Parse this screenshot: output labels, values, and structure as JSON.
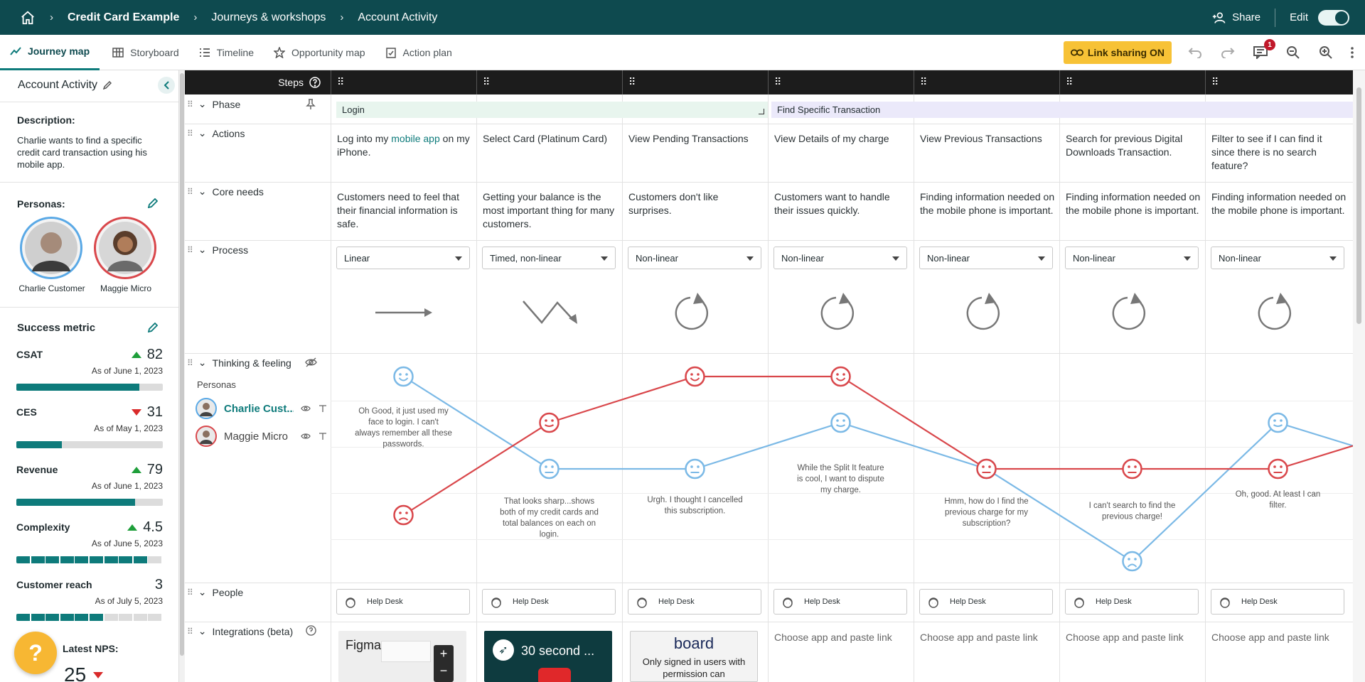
{
  "header": {
    "breadcrumbs": [
      "Credit Card Example",
      "Journeys & workshops",
      "Account Activity"
    ],
    "share_label": "Share",
    "edit_label": "Edit",
    "edit_on": true
  },
  "tabs": [
    {
      "label": "Journey map",
      "active": true,
      "icon": "line-chart-icon"
    },
    {
      "label": "Storyboard",
      "active": false,
      "icon": "grid-icon"
    },
    {
      "label": "Timeline",
      "active": false,
      "icon": "list-icon"
    },
    {
      "label": "Opportunity map",
      "active": false,
      "icon": "star-icon"
    },
    {
      "label": "Action plan",
      "active": false,
      "icon": "clipboard-check-icon"
    }
  ],
  "toolbar": {
    "link_sharing_label": "Link sharing ON",
    "comments_count": "1"
  },
  "sidebar": {
    "title": "Account Activity",
    "description_label": "Description:",
    "description": "Charlie wants to find a specific credit card transaction using his mobile app.",
    "personas_label": "Personas:",
    "personas": [
      {
        "name": "Charlie Customer",
        "ring": "#5aa9e6"
      },
      {
        "name": "Maggie Micro",
        "ring": "#d9474b"
      }
    ],
    "success_metric_label": "Success metric",
    "metrics": [
      {
        "name": "CSAT",
        "value": "82",
        "trend": "up",
        "asof": "As of June 1, 2023",
        "progress": 0.84,
        "segmented": false
      },
      {
        "name": "CES",
        "value": "31",
        "trend": "down",
        "asof": "As of May 1, 2023",
        "progress": 0.31,
        "segmented": false
      },
      {
        "name": "Revenue",
        "value": "79",
        "trend": "up",
        "asof": "As of June 1, 2023",
        "progress": 0.81,
        "segmented": false
      },
      {
        "name": "Complexity",
        "value": "4.5",
        "trend": "up",
        "asof": "As of June 5, 2023",
        "progress": 0.9,
        "segmented": true
      },
      {
        "name": "Customer reach",
        "value": "3",
        "trend": "none",
        "asof": "As of July 5, 2023",
        "progress": 0.6,
        "segmented": true
      }
    ],
    "nps_label": "Latest NPS:",
    "nps_value": "25",
    "nps_trend": "down"
  },
  "grid": {
    "steps_label": "Steps",
    "rows": {
      "phase": "Phase",
      "actions": "Actions",
      "core_needs": "Core needs",
      "process": "Process",
      "thinking": "Thinking & feeling",
      "people": "People",
      "integrations": "Integrations (beta)"
    },
    "personas_sub_label": "Personas",
    "persona_rows": [
      {
        "name": "Charlie Cust...",
        "color": "#0e7b7b",
        "ring": "#5aa9e6"
      },
      {
        "name": "Maggie Micro",
        "color": "#444",
        "ring": "#d9474b"
      }
    ],
    "phases": [
      {
        "label": "Login",
        "bg": "#e8f5ee"
      },
      {
        "label": "Find Specific Transaction",
        "bg": "#ebe9fa"
      }
    ],
    "actions": [
      {
        "pre": "Log into my ",
        "link": "mobile app",
        "post": " on my iPhone."
      },
      {
        "pre": "Select Card (Platinum Card)",
        "link": "",
        "post": ""
      },
      {
        "pre": "View Pending Transactions",
        "link": "",
        "post": ""
      },
      {
        "pre": "View Details of my charge",
        "link": "",
        "post": ""
      },
      {
        "pre": "View Previous Transactions",
        "link": "",
        "post": ""
      },
      {
        "pre": "Search for previous Digital Downloads Transaction.",
        "link": "",
        "post": ""
      },
      {
        "pre": "Filter to see if I can find it since there is no search feature?",
        "link": "",
        "post": ""
      }
    ],
    "core_needs": [
      "Customers need to feel that their financial information is safe.",
      "Getting your balance is the most important thing for many customers.",
      "Customers don't like surprises.",
      "Customers want to handle their issues quickly.",
      "Finding information needed on the mobile phone is important.",
      "Finding information needed on the mobile phone is important.",
      "Finding information needed on the mobile phone is important."
    ],
    "process": [
      {
        "value": "Linear",
        "icon": "arrow-right-icon"
      },
      {
        "value": "Timed, non-linear",
        "icon": "zigzag-arrow-icon"
      },
      {
        "value": "Non-linear",
        "icon": "cycle-icon"
      },
      {
        "value": "Non-linear",
        "icon": "cycle-icon"
      },
      {
        "value": "Non-linear",
        "icon": "cycle-icon"
      },
      {
        "value": "Non-linear",
        "icon": "cycle-icon"
      },
      {
        "value": "Non-linear",
        "icon": "cycle-icon"
      }
    ],
    "people": [
      "Help Desk",
      "Help Desk",
      "Help Desk",
      "Help Desk",
      "Help Desk",
      "Help Desk",
      "Help Desk"
    ],
    "integrations": [
      {
        "type": "thumb",
        "label": "Figma"
      },
      {
        "type": "thumb",
        "label": "30 second ..."
      },
      {
        "type": "thumb",
        "label": "board",
        "sub": "Only signed in users with permission can"
      },
      {
        "type": "link",
        "label": "Choose app and paste link"
      },
      {
        "type": "link",
        "label": "Choose app and paste link"
      },
      {
        "type": "link",
        "label": "Choose app and paste link"
      },
      {
        "type": "link",
        "label": "Choose app and paste link"
      }
    ]
  },
  "chart_data": {
    "type": "line",
    "categories": [
      "1",
      "2",
      "3",
      "4",
      "5",
      "6",
      "7",
      "8"
    ],
    "ylim": [
      1,
      5
    ],
    "series": [
      {
        "name": "Charlie Customer",
        "color": "#7bb9e6",
        "values": [
          5,
          3,
          3,
          4,
          3,
          1,
          4,
          3.5
        ]
      },
      {
        "name": "Maggie Micro",
        "color": "#d9474b",
        "values": [
          2,
          4,
          5,
          5,
          3,
          3,
          3,
          3.5
        ]
      }
    ],
    "annotations": [
      "Oh Good, it just used my face to login.  I can't always remember all these passwords.",
      "That looks sharp...shows both of my credit cards and total balances on each on login.",
      "Urgh. I thought I cancelled this subscription.",
      "While the Split It feature is cool, I want to dispute my charge.",
      "Hmm, how do I find the previous charge for my subscription?",
      "I can't search to find the previous charge!",
      "Oh, good. At least I can filter."
    ]
  }
}
